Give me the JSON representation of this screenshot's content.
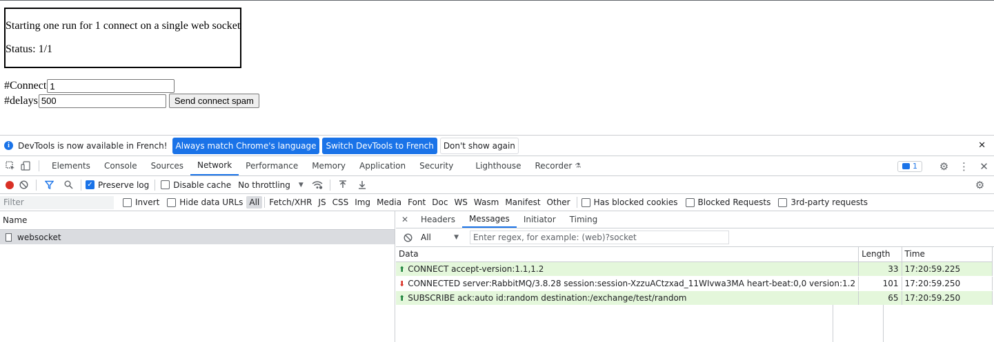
{
  "page": {
    "run_text": "Starting one run for 1 connect on a single web socket",
    "status_text": "Status: 1/1",
    "connect_label": "#Connect",
    "connect_value": "1",
    "delays_label": "#delays",
    "delays_value": "500",
    "send_button": "Send connect spam"
  },
  "devtools": {
    "infobar": {
      "text": "DevTools is now available in French!",
      "btn_match": "Always match Chrome's language",
      "btn_switch": "Switch DevTools to French",
      "btn_dismiss": "Don't show again"
    },
    "tabs": [
      "Elements",
      "Console",
      "Sources",
      "Network",
      "Performance",
      "Memory",
      "Application",
      "Security",
      "Lighthouse",
      "Recorder"
    ],
    "active_tab": "Network",
    "issues_count": "1",
    "toolbar": {
      "preserve_log": "Preserve log",
      "disable_cache": "Disable cache",
      "throttling": "No throttling"
    },
    "filterbar": {
      "placeholder": "Filter",
      "invert": "Invert",
      "hide_data_urls": "Hide data URLs",
      "types": [
        "All",
        "Fetch/XHR",
        "JS",
        "CSS",
        "Img",
        "Media",
        "Font",
        "Doc",
        "WS",
        "Wasm",
        "Manifest",
        "Other"
      ],
      "blocked_cookies": "Has blocked cookies",
      "blocked_requests": "Blocked Requests",
      "third_party": "3rd-party requests"
    },
    "requests": {
      "header": "Name",
      "items": [
        "websocket"
      ]
    },
    "detail": {
      "tabs": [
        "Headers",
        "Messages",
        "Initiator",
        "Timing"
      ],
      "active_tab": "Messages",
      "filter_select": "All",
      "regex_placeholder": "Enter regex, for example: (web)?socket",
      "columns": [
        "Data",
        "Length",
        "Time"
      ],
      "messages": [
        {
          "dir": "send",
          "data": "CONNECT accept-version:1.1,1.2",
          "length": "33",
          "time": "17:20:59.225"
        },
        {
          "dir": "recv",
          "data": "CONNECTED server:RabbitMQ/3.8.28 session:session-XzzuACtzxad_11WIvwa3MA heart-beat:0,0 version:1.2",
          "length": "101",
          "time": "17:20:59.250"
        },
        {
          "dir": "send",
          "data": "SUBSCRIBE ack:auto id:random destination:/exchange/test/random",
          "length": "65",
          "time": "17:20:59.250"
        }
      ]
    }
  }
}
